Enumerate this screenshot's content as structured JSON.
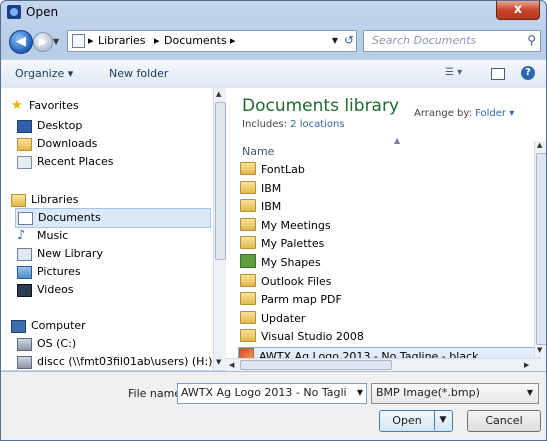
{
  "window": {
    "title": "Open",
    "close_label": "x"
  },
  "address_bar": {
    "crumbs": [
      "Libraries",
      "Documents"
    ],
    "search_placeholder": "Search Documents"
  },
  "toolbar": {
    "organize": "Organize ▾",
    "new_folder": "New folder"
  },
  "nav_pane": {
    "favorites": {
      "label": "Favorites",
      "items": [
        "Desktop",
        "Downloads",
        "Recent Places"
      ]
    },
    "libraries": {
      "label": "Libraries",
      "items": [
        "Documents",
        "Music",
        "New Library",
        "Pictures",
        "Videos"
      ],
      "selected": "Documents"
    },
    "computer": {
      "label": "Computer",
      "items": [
        "OS (C:)",
        "discc (\\\\fmt03fil01ab\\users) (H:)"
      ]
    }
  },
  "content": {
    "library_title": "Documents library",
    "includes_prefix": "Includes:",
    "includes_link": "2 locations",
    "arrange_prefix": "Arrange by:",
    "arrange_value": "Folder ▾",
    "column_name": "Name",
    "files": [
      {
        "name": "FontLab",
        "type": "folder"
      },
      {
        "name": "IBM",
        "type": "folder"
      },
      {
        "name": "IBM",
        "type": "folder"
      },
      {
        "name": "My Meetings",
        "type": "folder"
      },
      {
        "name": "My Palettes",
        "type": "folder"
      },
      {
        "name": "My Shapes",
        "type": "shapes"
      },
      {
        "name": "Outlook Files",
        "type": "folder"
      },
      {
        "name": "Parm map PDF",
        "type": "folder"
      },
      {
        "name": "Updater",
        "type": "folder"
      },
      {
        "name": "Visual Studio 2008",
        "type": "folder"
      },
      {
        "name": "AWTX Ag Logo 2013 - No Tagline - black",
        "type": "bmp"
      }
    ],
    "selected_index": 10
  },
  "bottom": {
    "file_name_label": "File name:",
    "file_name_value": "AWTX Ag Logo 2013 - No Tagline - b",
    "file_type_value": "BMP Image(*.bmp)",
    "open_label": "Open",
    "cancel_label": "Cancel"
  }
}
